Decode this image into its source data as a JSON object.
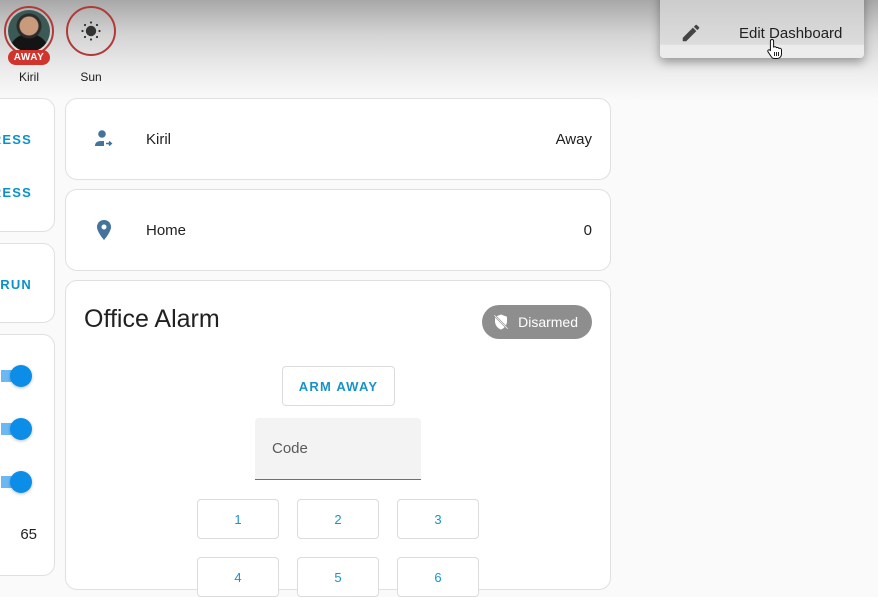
{
  "badges": [
    {
      "name": "Kiril",
      "status_tag": "AWAY",
      "icon": "person-avatar"
    },
    {
      "name": "Sun",
      "icon": "sun-icon"
    }
  ],
  "left_column": {
    "buttons": [
      "RESS",
      "RESS",
      "RUN"
    ],
    "sliders": [
      {
        "value_fraction": 1.0
      },
      {
        "value_fraction": 1.0
      },
      {
        "value_fraction": 1.0
      }
    ],
    "value": "65"
  },
  "entities": [
    {
      "icon": "account-arrow-right-icon",
      "name": "Kiril",
      "state": "Away"
    },
    {
      "icon": "map-marker-icon",
      "name": "Home",
      "state": "0"
    }
  ],
  "alarm": {
    "title": "Office Alarm",
    "state_label": "Disarmed",
    "state_icon": "shield-off-icon",
    "action_label": "ARM AWAY",
    "code_placeholder": "Code",
    "code_value": "",
    "keypad": [
      "1",
      "2",
      "3",
      "4",
      "5",
      "6"
    ]
  },
  "menu": {
    "items": [
      {
        "icon": "pencil-icon",
        "label": "Edit Dashboard"
      }
    ]
  },
  "colors": {
    "accent": "#1a93c8",
    "entity_icon": "#44739e",
    "away_badge": "#d0342c",
    "disarmed_chip": "#8e8e8e",
    "slider": "#0c8ee8"
  }
}
